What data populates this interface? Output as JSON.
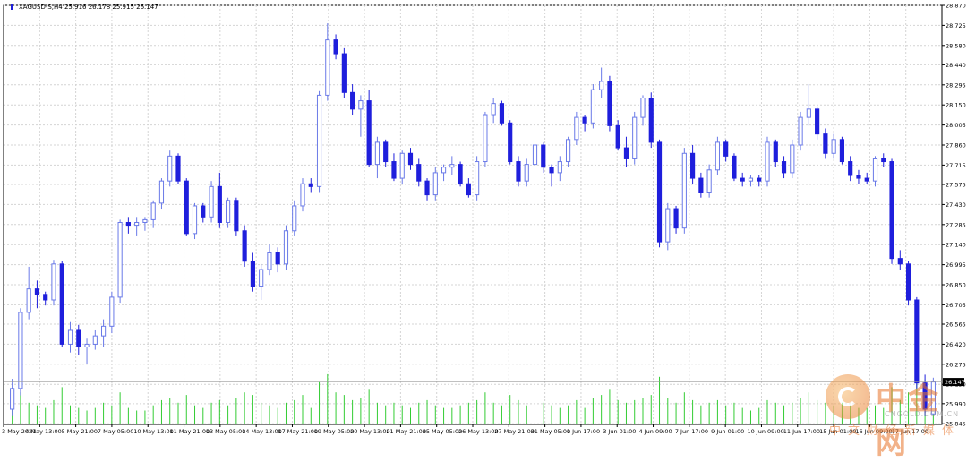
{
  "header": {
    "symbol_line": "XAGUSD-S,H4  25.916 26.178 25.915 26.147"
  },
  "watermark": {
    "brand_cn": "中金网",
    "brand_url": "CNGOLD.COM.CN",
    "brand_sub": "中文财经新媒体"
  },
  "colors": {
    "bull": "#6a7ae8",
    "bear": "#1f1fdc",
    "volume": "#33cc33",
    "grid": "#d4d4d4",
    "current_price_bg": "#000000"
  },
  "chart_data": {
    "type": "candlestick",
    "symbol": "XAGUSD-S",
    "timeframe": "H4",
    "header_ohlc": [
      25.916,
      26.178,
      25.915,
      26.147
    ],
    "current_price": 26.147,
    "ylim": [
      25.84,
      28.87
    ],
    "y_ticks": [
      28.87,
      28.725,
      28.58,
      28.44,
      28.295,
      28.15,
      28.005,
      27.86,
      27.715,
      27.575,
      27.43,
      27.285,
      27.14,
      26.995,
      26.85,
      26.705,
      26.565,
      26.42,
      26.275,
      26.13,
      25.99,
      25.845
    ],
    "y_tick_labels": [
      "28.870",
      "28.725",
      "28.580",
      "28.440",
      "28.295",
      "28.150",
      "28.005",
      "27.860",
      "27.715",
      "27.575",
      "27.430",
      "27.285",
      "27.140",
      "26.995",
      "26.850",
      "26.705",
      "26.565",
      "26.420",
      "26.275",
      "26.130",
      "25.990",
      "25.845"
    ],
    "x_tick_labels": [
      "3 May 2021",
      "4 May 13:00",
      "5 May 21:00",
      "7 May 05:00",
      "10 May 13:00",
      "11 May 21:00",
      "13 May 05:00",
      "14 May 13:00",
      "17 May 21:00",
      "19 May 05:00",
      "20 May 13:00",
      "21 May 21:00",
      "25 May 05:00",
      "26 May 13:00",
      "27 May 21:00",
      "31 May 05:00",
      "1 Jun 17:00",
      "3 Jun 01:00",
      "4 Jun 09:00",
      "7 Jun 17:00",
      "9 Jun 01:00",
      "10 Jun 09:00",
      "11 Jun 17:00",
      "15 Jun 01:00",
      "16 Jun 09:00",
      "17 Jun 17:00"
    ],
    "grid": true,
    "volume_panel": true,
    "candles": [
      [
        25.95,
        26.17,
        25.9,
        26.1
      ],
      [
        26.1,
        26.68,
        26.05,
        26.65
      ],
      [
        26.65,
        26.98,
        26.6,
        26.82
      ],
      [
        26.82,
        26.88,
        26.68,
        26.78
      ],
      [
        26.78,
        26.8,
        26.7,
        26.74
      ],
      [
        26.74,
        27.03,
        26.7,
        27.0
      ],
      [
        27.0,
        27.02,
        26.4,
        26.42
      ],
      [
        26.42,
        26.58,
        26.36,
        26.52
      ],
      [
        26.52,
        26.56,
        26.34,
        26.4
      ],
      [
        26.4,
        26.46,
        26.28,
        26.42
      ],
      [
        26.42,
        26.52,
        26.38,
        26.48
      ],
      [
        26.48,
        26.6,
        26.4,
        26.55
      ],
      [
        26.55,
        26.8,
        26.5,
        26.76
      ],
      [
        26.76,
        27.32,
        26.72,
        27.3
      ],
      [
        27.3,
        27.34,
        27.22,
        27.28
      ],
      [
        27.28,
        27.34,
        27.2,
        27.3
      ],
      [
        27.3,
        27.34,
        27.24,
        27.32
      ],
      [
        27.32,
        27.46,
        27.26,
        27.44
      ],
      [
        27.44,
        27.62,
        27.4,
        27.6
      ],
      [
        27.6,
        27.82,
        27.56,
        27.78
      ],
      [
        27.78,
        27.8,
        27.58,
        27.6
      ],
      [
        27.6,
        27.62,
        27.2,
        27.22
      ],
      [
        27.22,
        27.44,
        27.18,
        27.42
      ],
      [
        27.42,
        27.44,
        27.3,
        27.34
      ],
      [
        27.34,
        27.6,
        27.3,
        27.56
      ],
      [
        27.56,
        27.66,
        27.26,
        27.3
      ],
      [
        27.3,
        27.48,
        27.26,
        27.46
      ],
      [
        27.46,
        27.48,
        27.2,
        27.24
      ],
      [
        27.24,
        27.28,
        26.98,
        27.02
      ],
      [
        27.02,
        27.08,
        26.8,
        26.84
      ],
      [
        26.84,
        27.0,
        26.74,
        26.96
      ],
      [
        26.96,
        27.14,
        26.92,
        27.08
      ],
      [
        27.08,
        27.12,
        26.94,
        27.0
      ],
      [
        27.0,
        27.28,
        26.96,
        27.24
      ],
      [
        27.24,
        27.46,
        27.2,
        27.42
      ],
      [
        27.42,
        27.62,
        27.38,
        27.58
      ],
      [
        27.58,
        27.62,
        27.52,
        27.56
      ],
      [
        27.56,
        28.25,
        27.52,
        28.22
      ],
      [
        28.22,
        28.74,
        28.18,
        28.62
      ],
      [
        28.62,
        28.66,
        28.48,
        28.52
      ],
      [
        28.52,
        28.56,
        28.2,
        28.24
      ],
      [
        28.24,
        28.3,
        28.08,
        28.12
      ],
      [
        28.12,
        28.22,
        27.92,
        28.18
      ],
      [
        28.18,
        28.26,
        27.7,
        27.72
      ],
      [
        27.72,
        27.92,
        27.62,
        27.88
      ],
      [
        27.88,
        27.9,
        27.7,
        27.74
      ],
      [
        27.74,
        27.8,
        27.6,
        27.62
      ],
      [
        27.62,
        27.82,
        27.58,
        27.8
      ],
      [
        27.8,
        27.84,
        27.68,
        27.72
      ],
      [
        27.72,
        27.76,
        27.56,
        27.6
      ],
      [
        27.6,
        27.62,
        27.46,
        27.5
      ],
      [
        27.5,
        27.7,
        27.46,
        27.66
      ],
      [
        27.66,
        27.72,
        27.6,
        27.7
      ],
      [
        27.7,
        27.78,
        27.64,
        27.72
      ],
      [
        27.72,
        27.74,
        27.56,
        27.58
      ],
      [
        27.58,
        27.62,
        27.48,
        27.5
      ],
      [
        27.5,
        27.78,
        27.46,
        27.74
      ],
      [
        27.74,
        28.1,
        27.7,
        28.08
      ],
      [
        28.08,
        28.2,
        28.02,
        28.16
      ],
      [
        28.16,
        28.18,
        28.0,
        28.02
      ],
      [
        28.02,
        28.04,
        27.72,
        27.74
      ],
      [
        27.74,
        27.78,
        27.56,
        27.6
      ],
      [
        27.6,
        27.76,
        27.56,
        27.72
      ],
      [
        27.72,
        27.9,
        27.68,
        27.86
      ],
      [
        27.86,
        27.88,
        27.66,
        27.7
      ],
      [
        27.7,
        27.72,
        27.56,
        27.66
      ],
      [
        27.66,
        27.78,
        27.6,
        27.74
      ],
      [
        27.74,
        27.92,
        27.7,
        27.9
      ],
      [
        27.9,
        28.1,
        27.86,
        28.06
      ],
      [
        28.06,
        28.08,
        27.96,
        28.02
      ],
      [
        28.02,
        28.3,
        27.98,
        28.26
      ],
      [
        28.26,
        28.42,
        28.2,
        28.32
      ],
      [
        28.32,
        28.36,
        27.96,
        28.0
      ],
      [
        28.0,
        28.04,
        27.82,
        27.84
      ],
      [
        27.84,
        27.92,
        27.7,
        27.76
      ],
      [
        27.76,
        28.1,
        27.72,
        28.06
      ],
      [
        28.06,
        28.22,
        28.0,
        28.2
      ],
      [
        28.2,
        28.24,
        27.84,
        27.88
      ],
      [
        27.88,
        27.9,
        27.12,
        27.16
      ],
      [
        27.16,
        27.44,
        27.1,
        27.4
      ],
      [
        27.4,
        27.42,
        27.22,
        27.26
      ],
      [
        27.26,
        27.84,
        27.22,
        27.8
      ],
      [
        27.8,
        27.86,
        27.58,
        27.62
      ],
      [
        27.62,
        27.66,
        27.48,
        27.52
      ],
      [
        27.52,
        27.72,
        27.48,
        27.68
      ],
      [
        27.68,
        27.92,
        27.64,
        27.88
      ],
      [
        27.88,
        27.9,
        27.74,
        27.78
      ],
      [
        27.78,
        27.8,
        27.6,
        27.62
      ],
      [
        27.62,
        27.66,
        27.56,
        27.6
      ],
      [
        27.6,
        27.64,
        27.56,
        27.62
      ],
      [
        27.62,
        27.64,
        27.56,
        27.6
      ],
      [
        27.6,
        27.92,
        27.56,
        27.88
      ],
      [
        27.88,
        27.9,
        27.7,
        27.74
      ],
      [
        27.74,
        27.78,
        27.62,
        27.66
      ],
      [
        27.66,
        27.9,
        27.62,
        27.86
      ],
      [
        27.86,
        28.1,
        27.82,
        28.06
      ],
      [
        28.06,
        28.3,
        28.0,
        28.12
      ],
      [
        28.12,
        28.14,
        27.9,
        27.94
      ],
      [
        27.94,
        27.98,
        27.76,
        27.8
      ],
      [
        27.8,
        27.94,
        27.76,
        27.9
      ],
      [
        27.9,
        27.92,
        27.72,
        27.74
      ],
      [
        27.74,
        27.78,
        27.6,
        27.64
      ],
      [
        27.64,
        27.68,
        27.58,
        27.62
      ],
      [
        27.62,
        27.66,
        27.58,
        27.6
      ],
      [
        27.6,
        27.78,
        27.56,
        27.76
      ],
      [
        27.76,
        27.8,
        27.7,
        27.74
      ],
      [
        27.74,
        27.76,
        27.0,
        27.04
      ],
      [
        27.04,
        27.1,
        26.96,
        27.0
      ],
      [
        27.0,
        27.02,
        26.7,
        26.74
      ],
      [
        26.74,
        26.76,
        26.1,
        26.14
      ],
      [
        26.14,
        26.2,
        25.9,
        25.95
      ],
      [
        25.916,
        26.178,
        25.915,
        26.147
      ]
    ],
    "volumes": [
      0.55,
      0.6,
      0.4,
      0.35,
      0.3,
      0.45,
      0.7,
      0.35,
      0.3,
      0.25,
      0.3,
      0.4,
      0.35,
      0.6,
      0.3,
      0.25,
      0.25,
      0.35,
      0.45,
      0.5,
      0.4,
      0.55,
      0.35,
      0.3,
      0.4,
      0.45,
      0.35,
      0.5,
      0.6,
      0.55,
      0.4,
      0.35,
      0.3,
      0.4,
      0.45,
      0.55,
      0.3,
      0.8,
      0.95,
      0.6,
      0.55,
      0.45,
      0.5,
      0.65,
      0.4,
      0.35,
      0.4,
      0.35,
      0.3,
      0.4,
      0.45,
      0.35,
      0.3,
      0.3,
      0.35,
      0.4,
      0.45,
      0.6,
      0.4,
      0.35,
      0.55,
      0.45,
      0.35,
      0.4,
      0.4,
      0.35,
      0.3,
      0.35,
      0.45,
      0.3,
      0.5,
      0.55,
      0.65,
      0.45,
      0.4,
      0.45,
      0.5,
      0.55,
      0.9,
      0.5,
      0.4,
      0.6,
      0.45,
      0.35,
      0.4,
      0.45,
      0.35,
      0.4,
      0.3,
      0.25,
      0.3,
      0.45,
      0.4,
      0.35,
      0.4,
      0.5,
      0.6,
      0.45,
      0.4,
      0.35,
      0.4,
      0.35,
      0.3,
      0.3,
      0.35,
      0.3,
      0.7,
      0.45,
      0.6,
      0.9,
      0.85,
      0.4
    ]
  }
}
